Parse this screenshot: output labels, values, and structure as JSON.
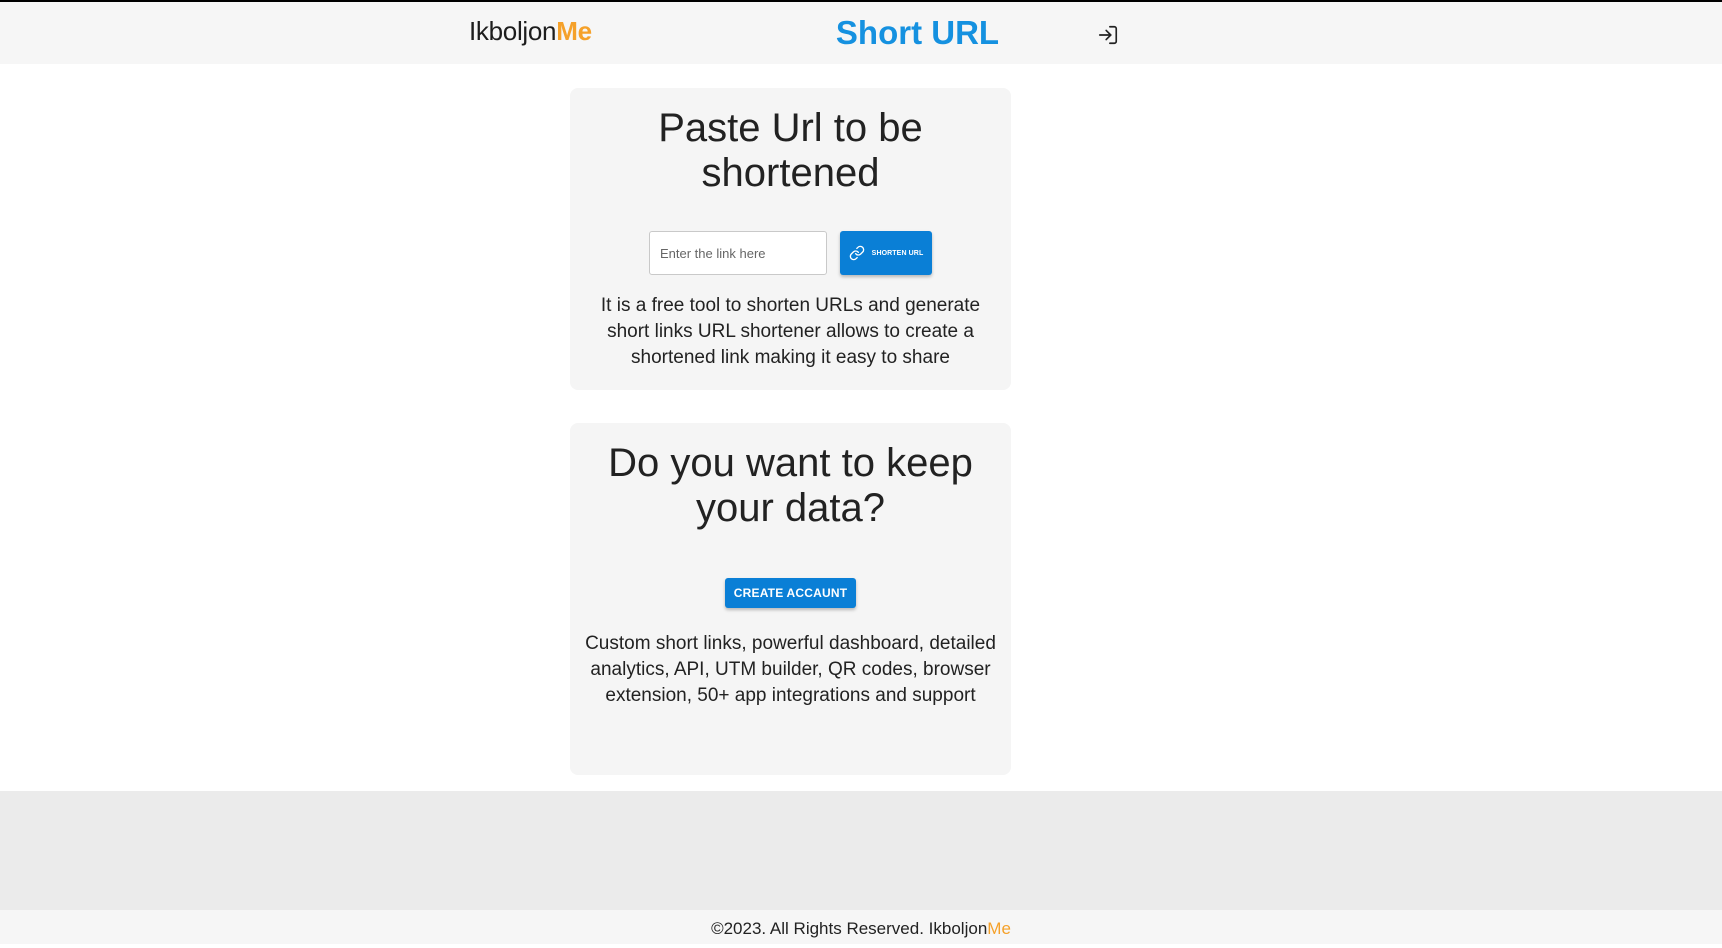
{
  "header": {
    "brand_main": "Ikboljon",
    "brand_accent": "Me",
    "title": "Short URL",
    "login_icon": "sign-in-icon"
  },
  "shorten_card": {
    "heading": "Paste Url to be shortened",
    "input_placeholder": "Enter the link here",
    "input_value": "",
    "button_label": "SHORTEN URL",
    "button_icon": "link-icon",
    "description": "It is a free tool to shorten URLs and generate short links URL shortener allows to create a shortened link making it easy to share"
  },
  "account_card": {
    "heading": "Do you want to keep your data?",
    "button_label": "CREATE ACCAUNT",
    "description": "Custom short links, powerful dashboard, detailed analytics, API, UTM builder, QR codes, browser extension, 50+ app integrations and support"
  },
  "footer": {
    "text": "©2023. All Rights Reserved. ",
    "brand_main": "Ikboljon",
    "brand_accent": "Me"
  },
  "colors": {
    "accent_blue": "#1591e0",
    "button_blue": "#0a7fd6",
    "brand_orange": "#f5a12a"
  }
}
